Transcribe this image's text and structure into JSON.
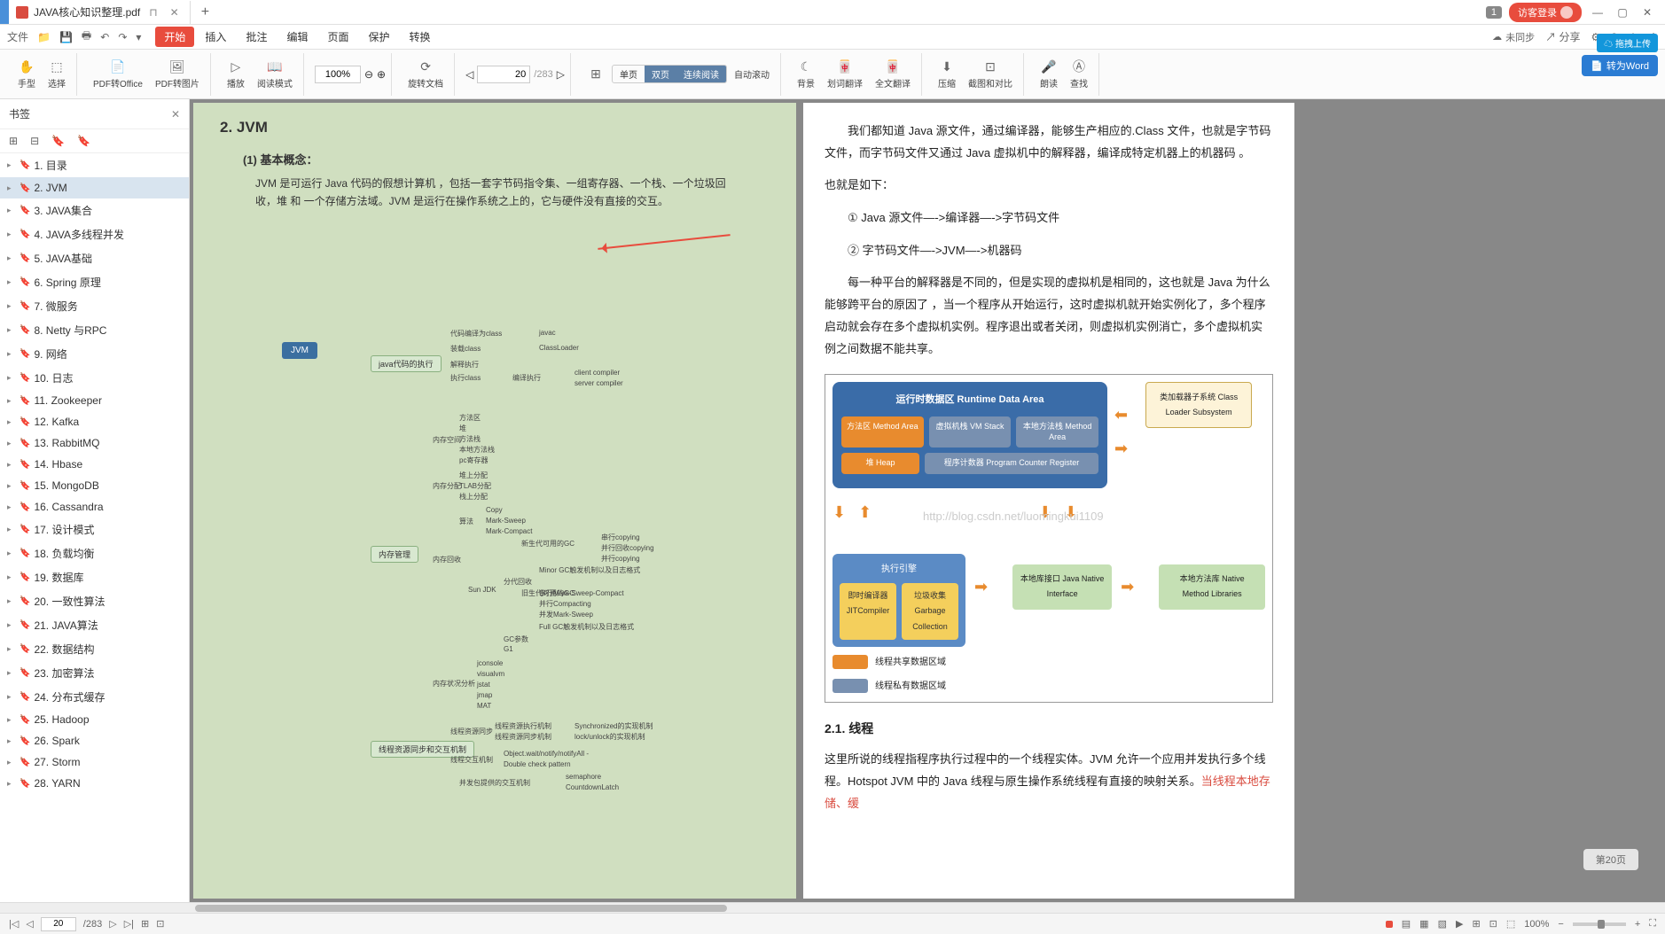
{
  "tab": {
    "title": "JAVA核心知识整理.pdf"
  },
  "titlebar": {
    "badge": "1",
    "login": "访客登录"
  },
  "menubar": {
    "tabs": [
      "开始",
      "插入",
      "批注",
      "编辑",
      "页面",
      "保护",
      "转换"
    ],
    "sync": "未同步",
    "share": "分享"
  },
  "toolbar": {
    "hand": "手型",
    "select": "选择",
    "pdf_to_office": "PDF转Office",
    "pdf_to_img": "PDF转图片",
    "play": "播放",
    "read_mode": "阅读模式",
    "zoom": "100%",
    "rotate": "旋转文档",
    "page_current": "20",
    "page_total": "/283",
    "single": "单页",
    "double": "双页",
    "continuous": "连续阅读",
    "auto_scroll": "自动滚动",
    "bg": "背景",
    "pick_translate": "划词翻译",
    "full_translate": "全文翻译",
    "compress": "压缩",
    "screenshot": "截图和对比",
    "read_aloud": "朗读",
    "find": "查找",
    "word_convert": "转为Word",
    "blue_btn": "拖拽上传"
  },
  "sidebar": {
    "title": "书签",
    "items": [
      "1. 目录",
      "2. JVM",
      "3. JAVA集合",
      "4. JAVA多线程并发",
      "5. JAVA基础",
      "6. Spring 原理",
      "7.  微服务",
      "8. Netty 与RPC",
      "9. 网络",
      "10. 日志",
      "11. Zookeeper",
      "12. Kafka",
      "13. RabbitMQ",
      "14. Hbase",
      "15. MongoDB",
      "16. Cassandra",
      "17. 设计模式",
      "18. 负载均衡",
      "19.  数据库",
      "20.  一致性算法",
      "21. JAVA算法",
      "22. 数据结构",
      "23. 加密算法",
      "24. 分布式缓存",
      "25. Hadoop",
      "26. Spark",
      "27. Storm",
      "28. YARN"
    ],
    "selected_index": 1
  },
  "doc_left": {
    "title": "2. JVM",
    "concept_label": "(1) 基本概念：",
    "concept_text": "JVM 是可运行 Java 代码的假想计算机 ，包括一套字节码指令集、一组寄存器、一个栈、一个垃圾回收，堆 和 一个存储方法域。JVM 是运行在操作系统之上的，它与硬件没有直接的交互。",
    "mindmap": {
      "root": "JVM",
      "branches": [
        {
          "node": "java代码的执行",
          "children": [
            "代码编译为class → javac",
            "装载class → ClassLoader",
            "执行class → 解释执行 / 编译执行 → client compiler / server compiler"
          ]
        },
        {
          "node": "内存管理",
          "children": [
            "内存空间 → 方法区 / 堆 / 方法栈 / 本地方法栈 / pc寄存器",
            "内存分配 → 堆上分配 / TLAB分配 / 栈上分配",
            "内存回收 → 算法(Copy/Mark-Sweep/Mark-Compact) / 新生代可用的GC(串行copying/并行回收copying/并行copying) / Minor GC触发机制以及日志格式 / 分代回收 / 旧生代可用的GC(串行Mark-Sweep-Compact/并行Compacting/并发Mark-Sweep) / Full GC触发机制以及日志格式 / Sun JDK / GC参数 / G1",
            "内存状况分析 → jconsole / visualvm / jstat / jmap / MAT"
          ]
        },
        {
          "node": "线程资源同步和交互机制",
          "children": [
            "线程资源同步 → 线程资源执行机制 / 线程资源同步机制 / Synchronized的实现机制 / lock/unlock的实现机制",
            "线程交互机制 → Object.wait/notify/notifyAll - Double check pattern",
            "并发包提供的交互机制 → semaphore / CountdownLatch"
          ]
        }
      ]
    }
  },
  "doc_right": {
    "p1": "我们都知道 Java 源文件，通过编译器，能够生产相应的.Class 文件，也就是字节码文件，而字节码文件又通过 Java 虚拟机中的解释器，编译成特定机器上的机器码 。",
    "p2": "也就是如下：",
    "step1": "① Java 源文件—->编译器—->字节码文件",
    "step2": "② 字节码文件—->JVM—->机器码",
    "p3": "每一种平台的解释器是不同的，但是实现的虚拟机是相同的，这也就是 Java 为什么能够跨平台的原因了 ，当一个程序从开始运行，这时虚拟机就开始实例化了，多个程序启动就会存在多个虚拟机实例。程序退出或者关闭，则虚拟机实例消亡，多个虚拟机实例之间数据不能共享。",
    "diagram": {
      "runtime_title": "运行时数据区  Runtime Data Area",
      "method_area": "方法区\nMethod Area",
      "vm_stack": "虚拟机栈\nVM Stack",
      "native_method_area": "本地方法栈\nMethod Area",
      "heap": "堆\nHeap",
      "pc_register": "程序计数器\nProgram Counter Register",
      "classloader": "类加载器子系统\nClass Loader Subsystem",
      "engine_title": "执行引擎",
      "jit": "即时编译器\nJITCompiler",
      "gc": "垃圾收集\nGarbage Collection",
      "jni": "本地库接口\nJava Native Interface",
      "nml": "本地方法库\nNative Method Libraries",
      "legend_shared": "线程共享数据区域",
      "legend_private": "线程私有数据区域",
      "watermark": "http://blog.csdn.net/luomingkui1109"
    },
    "h_thread": "2.1. 线程",
    "p_thread": "这里所说的线程指程序执行过程中的一个线程实体。JVM 允许一个应用并发执行多个线程。Hotspot JVM 中的 Java 线程与原生操作系统线程有直接的映射关系。",
    "p_thread_red": "当线程本地存储、缓"
  },
  "page_indicator": "第20页",
  "statusbar": {
    "page_current": "20",
    "page_total": "/283",
    "zoom": "100%"
  }
}
